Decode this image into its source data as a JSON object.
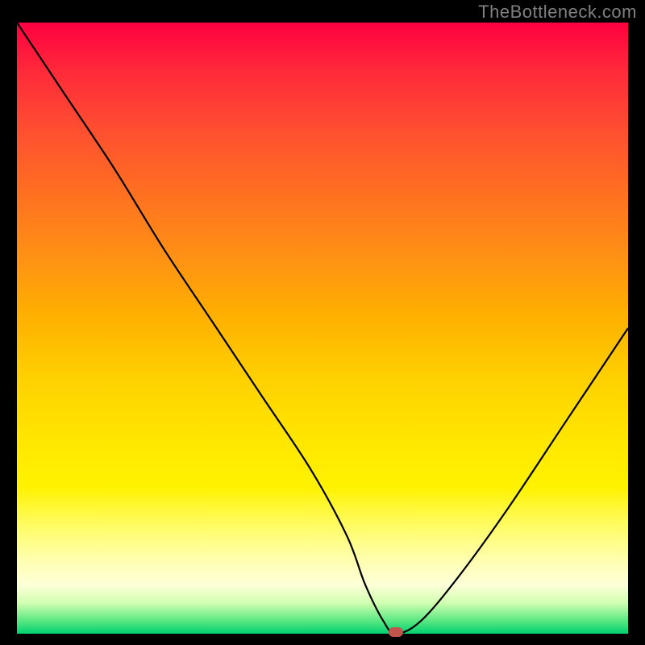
{
  "watermark": "TheBottleneck.com",
  "chart_data": {
    "type": "line",
    "title": "",
    "xlabel": "",
    "ylabel": "",
    "xlim": [
      0,
      100
    ],
    "ylim": [
      0,
      100
    ],
    "grid": false,
    "legend": false,
    "series": [
      {
        "name": "bottleneck-curve",
        "x": [
          0,
          8,
          16,
          24,
          32,
          40,
          48,
          54,
          57,
          60,
          62,
          66,
          72,
          80,
          90,
          100
        ],
        "values": [
          100,
          88,
          76,
          63,
          51,
          39,
          27,
          16,
          8,
          2,
          0,
          2,
          9,
          20,
          35,
          50
        ]
      }
    ],
    "marker": {
      "x": 62,
      "y": 0,
      "color": "#c1554b"
    },
    "background_gradient": {
      "top": "#ff0040",
      "mid": "#ffd000",
      "bottom": "#00d070"
    }
  }
}
